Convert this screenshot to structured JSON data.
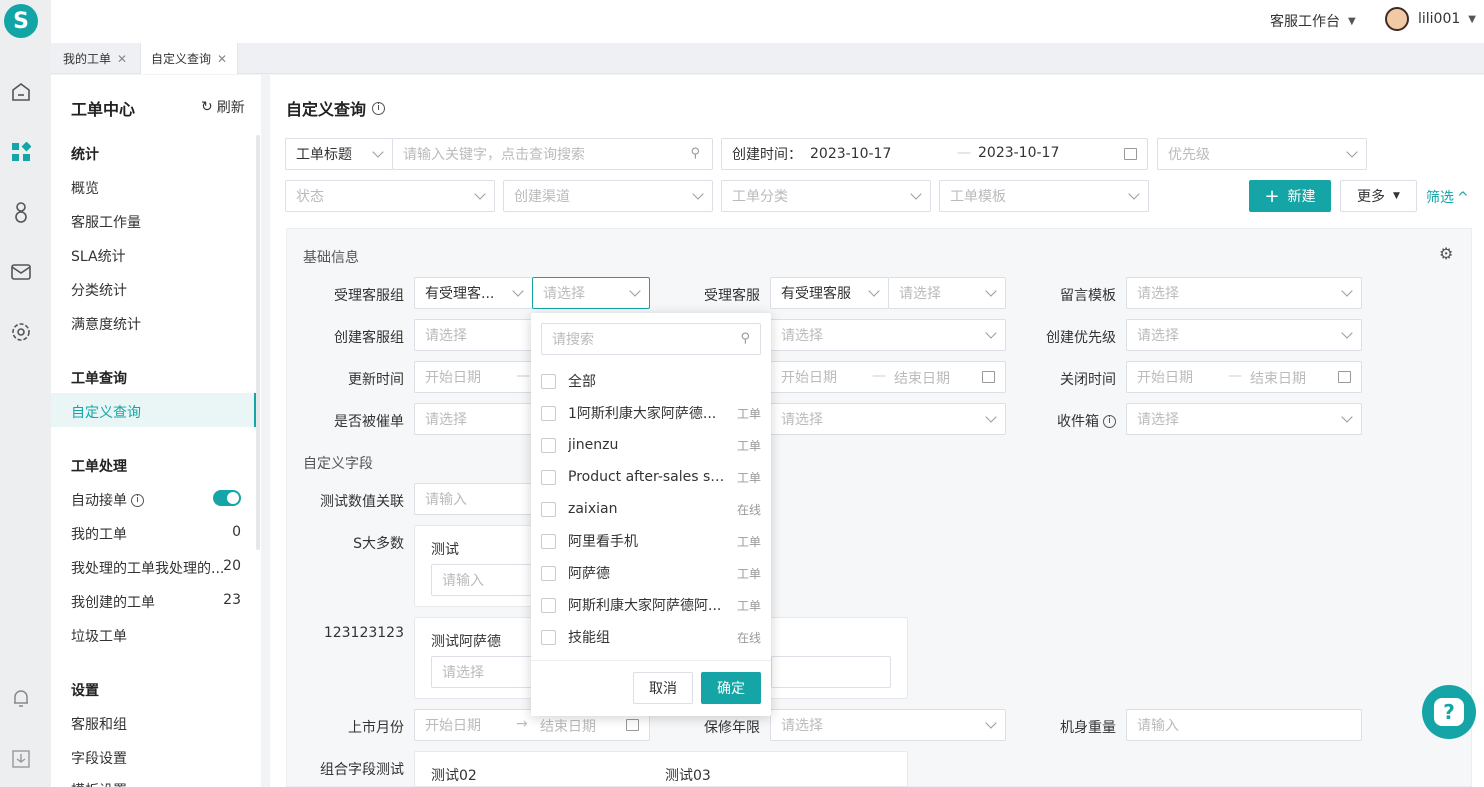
{
  "topbar": {
    "workspace": "客服工作台",
    "username": "lili001"
  },
  "tabs": [
    {
      "label": "我的工单"
    },
    {
      "label": "自定义查询"
    }
  ],
  "nav": {
    "title": "工单中心",
    "refresh": "刷新",
    "stats": {
      "header": "统计",
      "items": [
        "概览",
        "客服工作量",
        "SLA统计",
        "分类统计",
        "满意度统计"
      ]
    },
    "query": {
      "header": "工单查询",
      "items": [
        "自定义查询"
      ]
    },
    "processing": {
      "header": "工单处理",
      "auto": "自动接单",
      "items": [
        {
          "label": "我的工单",
          "count": "0"
        },
        {
          "label": "我处理的工单我处理的...",
          "count": "20"
        },
        {
          "label": "我创建的工单",
          "count": "23"
        },
        {
          "label": "垃圾工单",
          "count": ""
        }
      ]
    },
    "settings": {
      "header": "设置",
      "items": [
        "客服和组",
        "字段设置",
        "模板设置"
      ]
    }
  },
  "page": {
    "title": "自定义查询"
  },
  "filters": {
    "title_type": "工单标题",
    "keyword_placeholder": "请输入关键字，点击查询搜索",
    "created_label": "创建时间：",
    "date_start": "2023-10-17",
    "date_end": "2023-10-17",
    "priority": "优先级",
    "status": "状态",
    "channel": "创建渠道",
    "category": "工单分类",
    "template": "工单模板",
    "new": "新建",
    "more": "更多",
    "filter": "筛选"
  },
  "basic": {
    "header": "基础信息",
    "accept_group": "受理客服组",
    "accept_group_val": "有受理客...",
    "select": "请选择",
    "accept_agent": "受理客服",
    "accept_agent_val": "有受理客服",
    "msg_template": "留言模板",
    "create_group": "创建客服组",
    "create_priority": "创建优先级",
    "update_time": "更新时间",
    "start_date": "开始日期",
    "end_date": "结束日期",
    "close_time": "关闭时间",
    "urged": "是否被催单",
    "inbox": "收件箱"
  },
  "custom": {
    "header": "自定义字段",
    "num_rel": "测试数值关联",
    "input": "请输入",
    "s_most": "S大多数",
    "test": "测试",
    "f123": "123123123",
    "test_asd": "测试阿萨德",
    "market_month": "上市月份",
    "warranty": "保修年限",
    "weight": "机身重量",
    "combo": "组合字段测试",
    "test02": "测试02",
    "test03": "测试03"
  },
  "dropdown": {
    "search": "请搜索",
    "all": "全部",
    "options": [
      {
        "label": "1阿斯利康大家阿萨德...",
        "tag": "工单"
      },
      {
        "label": "jinenzu",
        "tag": "工单"
      },
      {
        "label": "Product after-sales ski...",
        "tag": "工单"
      },
      {
        "label": "zaixian",
        "tag": "在线"
      },
      {
        "label": "阿里看手机",
        "tag": "工单"
      },
      {
        "label": "阿萨德",
        "tag": "工单"
      },
      {
        "label": "阿斯利康大家阿萨德阿...",
        "tag": "工单"
      },
      {
        "label": "技能组",
        "tag": "在线"
      }
    ],
    "cancel": "取消",
    "confirm": "确定"
  },
  "colors": {
    "accent": "#15a5a6"
  }
}
